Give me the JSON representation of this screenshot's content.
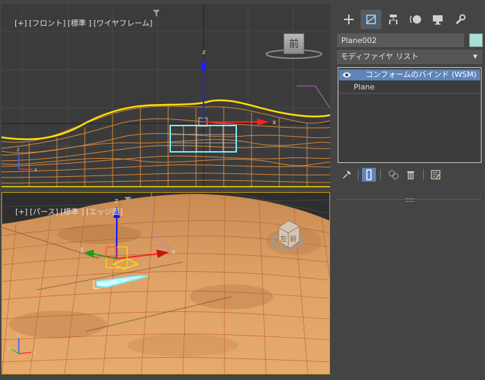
{
  "viewports": {
    "front": {
      "label_parts": [
        "[+]",
        "[フロント]",
        "[標準 ]",
        "[ワイヤフレーム]"
      ],
      "viewcube_label": "前"
    },
    "perspective": {
      "label_parts": [
        "[+]",
        "[パース]",
        "[標準 ]",
        "[エッジ面]"
      ],
      "viewcube_labels": [
        "左",
        "前"
      ]
    }
  },
  "panel": {
    "tabs": [
      {
        "name": "create",
        "icon": "plus-icon"
      },
      {
        "name": "modify",
        "icon": "modify-icon",
        "active": true
      },
      {
        "name": "hierarchy",
        "icon": "hierarchy-icon"
      },
      {
        "name": "motion",
        "icon": "motion-icon"
      },
      {
        "name": "display",
        "icon": "display-icon"
      },
      {
        "name": "utilities",
        "icon": "wrench-icon"
      }
    ],
    "object_name": "Plane002",
    "object_color": "#a6e0d8",
    "modifier_list_label": "モディファイヤ リスト",
    "stack": {
      "items": [
        {
          "label": "コンフォームのバインド (WSM)",
          "selected": true
        },
        {
          "label": "Plane",
          "selected": false
        }
      ]
    },
    "stack_tools": [
      "pin-stack-icon",
      "show-end-result-icon",
      "make-unique-icon",
      "remove-modifier-icon",
      "configure-sets-icon"
    ]
  },
  "colors": {
    "accent": "#5e84b8",
    "wire_orange": "#d98a3a",
    "selection_yellow": "#ffe000",
    "selected_plane": "#7ff0ff"
  }
}
